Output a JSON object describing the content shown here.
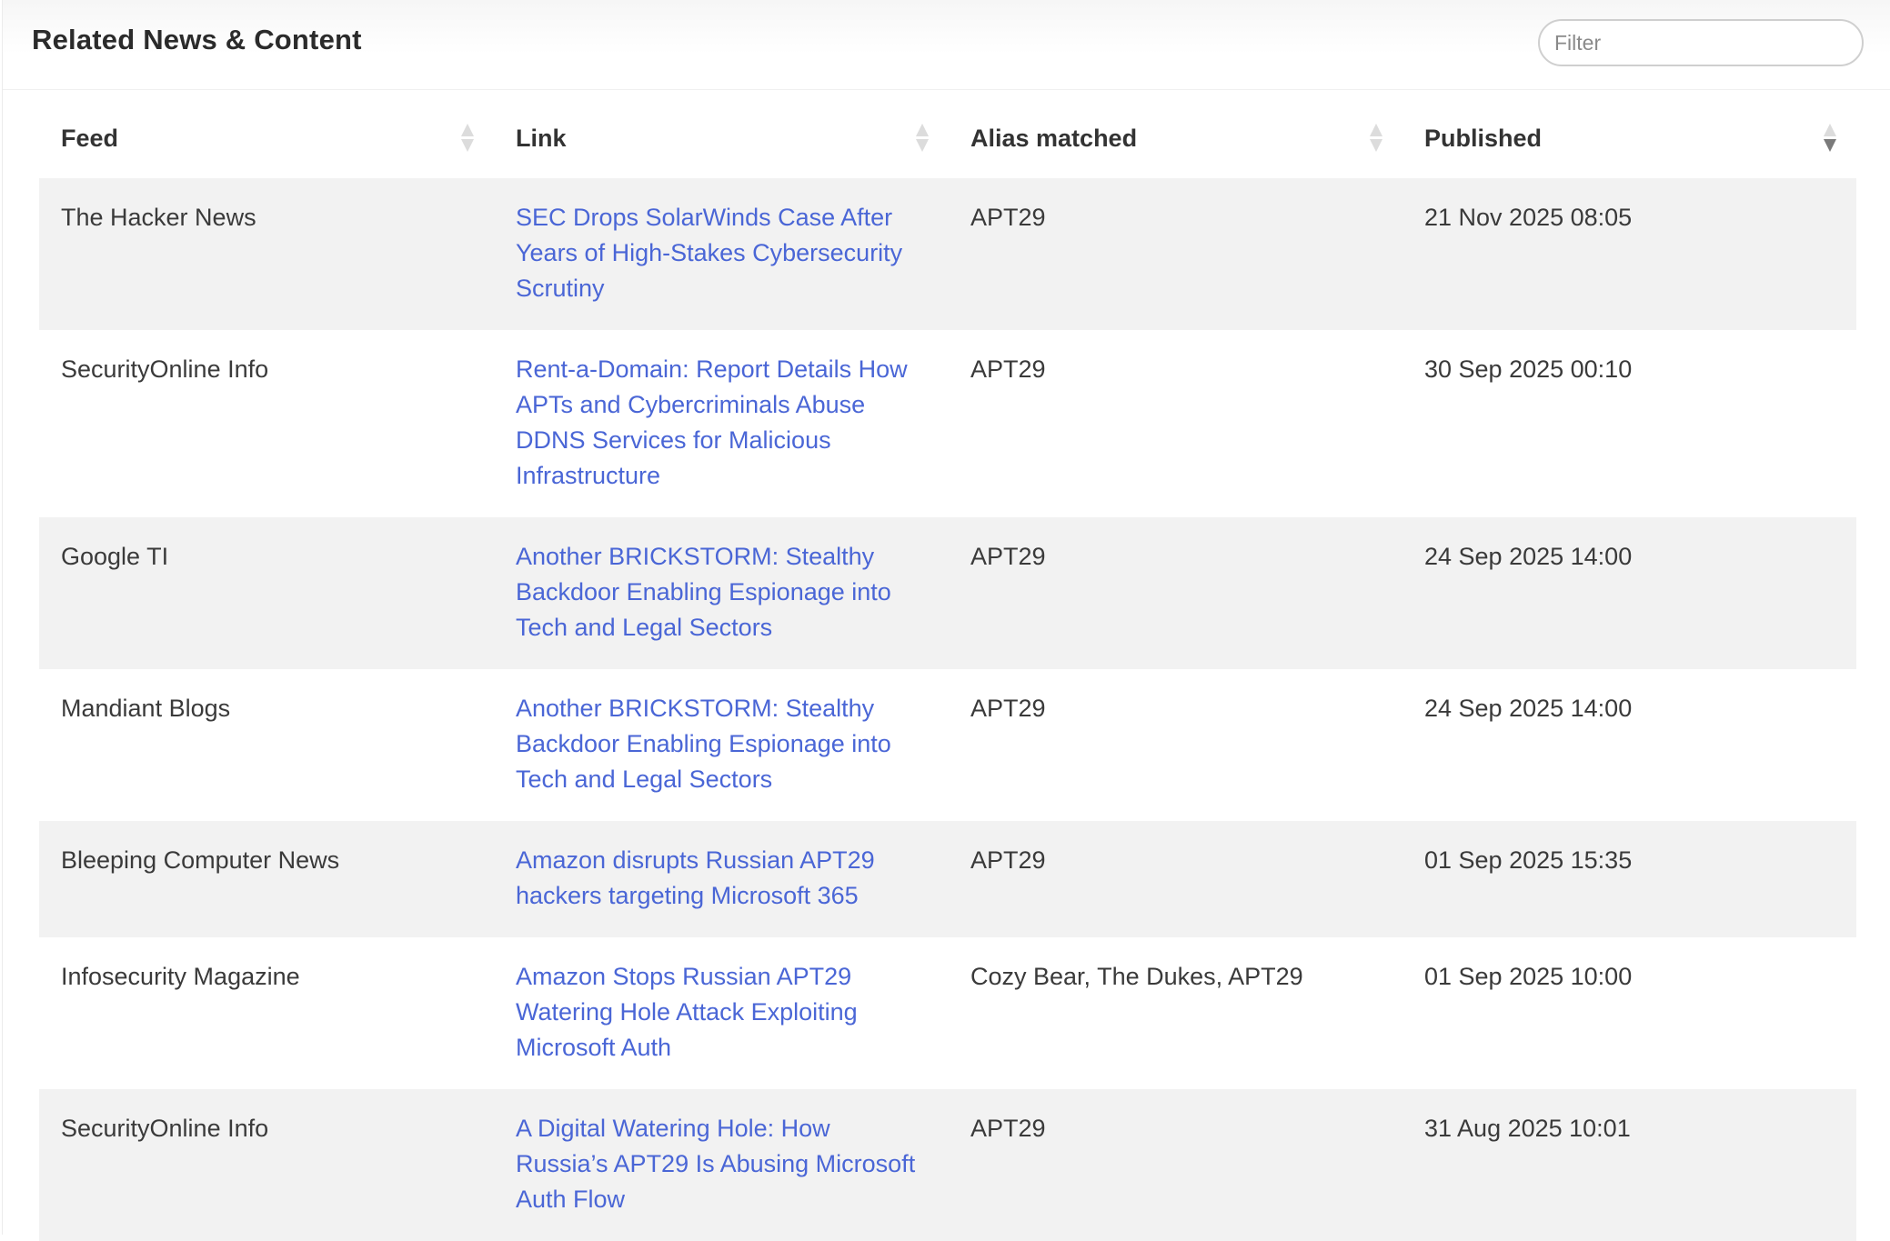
{
  "panel": {
    "title": "Related News & Content",
    "filter_placeholder": "Filter"
  },
  "table": {
    "columns": [
      "Feed",
      "Link",
      "Alias matched",
      "Published"
    ],
    "sort": {
      "column": "Published",
      "direction": "descending"
    },
    "rows": [
      {
        "feed": "The Hacker News",
        "link": "SEC Drops SolarWinds Case After Years of High-Stakes Cybersecurity Scrutiny",
        "alias": "APT29",
        "published": "21 Nov 2025 08:05"
      },
      {
        "feed": "SecurityOnline Info",
        "link": "Rent-a-Domain: Report Details How APTs and Cybercriminals Abuse DDNS Services for Malicious Infrastructure",
        "alias": "APT29",
        "published": "30 Sep 2025 00:10"
      },
      {
        "feed": "Google TI",
        "link": "Another BRICKSTORM: Stealthy Backdoor Enabling Espionage into Tech and Legal Sectors",
        "alias": "APT29",
        "published": "24 Sep 2025 14:00"
      },
      {
        "feed": "Mandiant Blogs",
        "link": "Another BRICKSTORM: Stealthy Backdoor Enabling Espionage into Tech and Legal Sectors",
        "alias": "APT29",
        "published": "24 Sep 2025 14:00"
      },
      {
        "feed": "Bleeping Computer News",
        "link": "Amazon disrupts Russian APT29 hackers targeting Microsoft 365",
        "alias": "APT29",
        "published": "01 Sep 2025 15:35"
      },
      {
        "feed": "Infosecurity Magazine",
        "link": "Amazon Stops Russian APT29 Watering Hole Attack Exploiting Microsoft Auth",
        "alias": "Cozy Bear, The Dukes, APT29",
        "published": "01 Sep 2025 10:00"
      },
      {
        "feed": "SecurityOnline Info",
        "link": "A Digital Watering Hole: How Russia’s APT29 Is Abusing Microsoft Auth Flow",
        "alias": "APT29",
        "published": "31 Aug 2025 10:01"
      }
    ]
  },
  "colors": {
    "link": "#4a66d6",
    "row_shade": "#f2f2f2",
    "sort_active": "#7a7a7a",
    "sort_inactive": "#dcdcdc"
  }
}
